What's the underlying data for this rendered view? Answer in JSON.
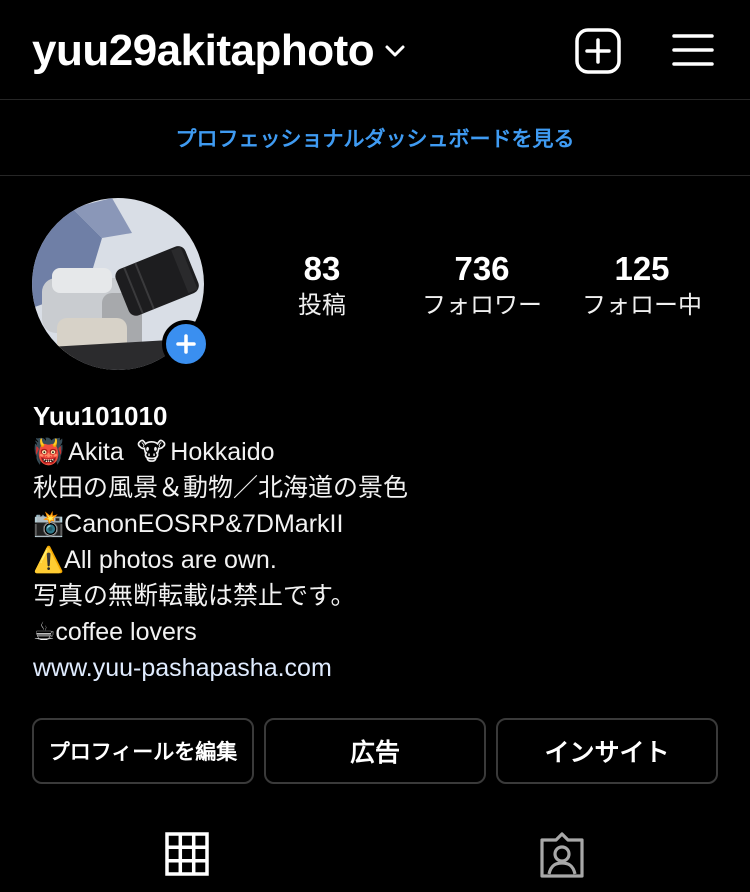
{
  "header": {
    "username": "yuu29akitaphoto",
    "chevron_icon": "chevron-down-icon",
    "new_post_icon": "plus-square-icon",
    "menu_icon": "hamburger-menu-icon"
  },
  "dashboard": {
    "label": "プロフェッショナルダッシュボードを見る",
    "color": "#3f9bf2"
  },
  "profile": {
    "avatar_icon": "camera-photo-avatar",
    "add_story_icon": "plus-icon",
    "add_story_color": "#3a8ff0",
    "stats": [
      {
        "value": "83",
        "label": "投稿"
      },
      {
        "value": "736",
        "label": "フォロワー"
      },
      {
        "value": "125",
        "label": "フォロー中"
      }
    ]
  },
  "bio": {
    "name": "Yuu101010",
    "lines": [
      {
        "emoji": "👹",
        "text": "Akita"
      },
      {
        "emoji": "🐮",
        "text": "Hokkaido"
      },
      {
        "emoji": "",
        "text": "秋田の風景＆動物／北海道の景色"
      },
      {
        "emoji": "📸",
        "text": "CanonEOSRP&7DMarkII"
      },
      {
        "emoji": "⚠️",
        "text": "All photos are own."
      },
      {
        "emoji": "",
        "text": "写真の無断転載は禁止です。"
      },
      {
        "emoji": "☕",
        "text": "coffee lovers"
      }
    ],
    "link": "www.yuu-pashapasha.com"
  },
  "actions": {
    "edit_profile": "プロフィールを編集",
    "ads": "広告",
    "insights": "インサイト"
  },
  "tabs": {
    "grid_icon": "grid-icon",
    "tagged_icon": "tagged-person-icon"
  }
}
